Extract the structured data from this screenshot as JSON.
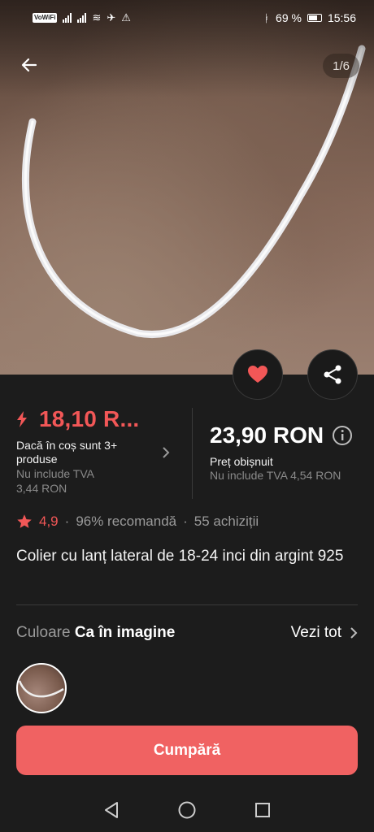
{
  "status_bar": {
    "carrier_tag": "VoWiFi",
    "battery": "69 %",
    "time": "15:56"
  },
  "gallery": {
    "counter": "1/6"
  },
  "price": {
    "flash_price": "18,10 R...",
    "flash_condition": "Dacă în coș sunt 3+ produse",
    "flash_vat_note": "Nu include TVA",
    "flash_vat_amount": "3,44 RON",
    "regular_price": "23,90 RON",
    "regular_label": "Preț obișnuit",
    "regular_vat_note": "Nu include TVA 4,54 RON"
  },
  "rating": {
    "score": "4,9",
    "recommend": "96% recomandă",
    "purchases": "55 achiziții",
    "separator": "·"
  },
  "product": {
    "title": "Colier cu lanț lateral de 18-24 inci din argint 925"
  },
  "variant": {
    "label": "Culoare",
    "value": "Ca în imagine",
    "see_all": "Vezi tot"
  },
  "actions": {
    "buy": "Cumpără"
  },
  "colors": {
    "accent": "#f25757",
    "buy_button": "#f06262",
    "background": "#1c1c1c"
  }
}
